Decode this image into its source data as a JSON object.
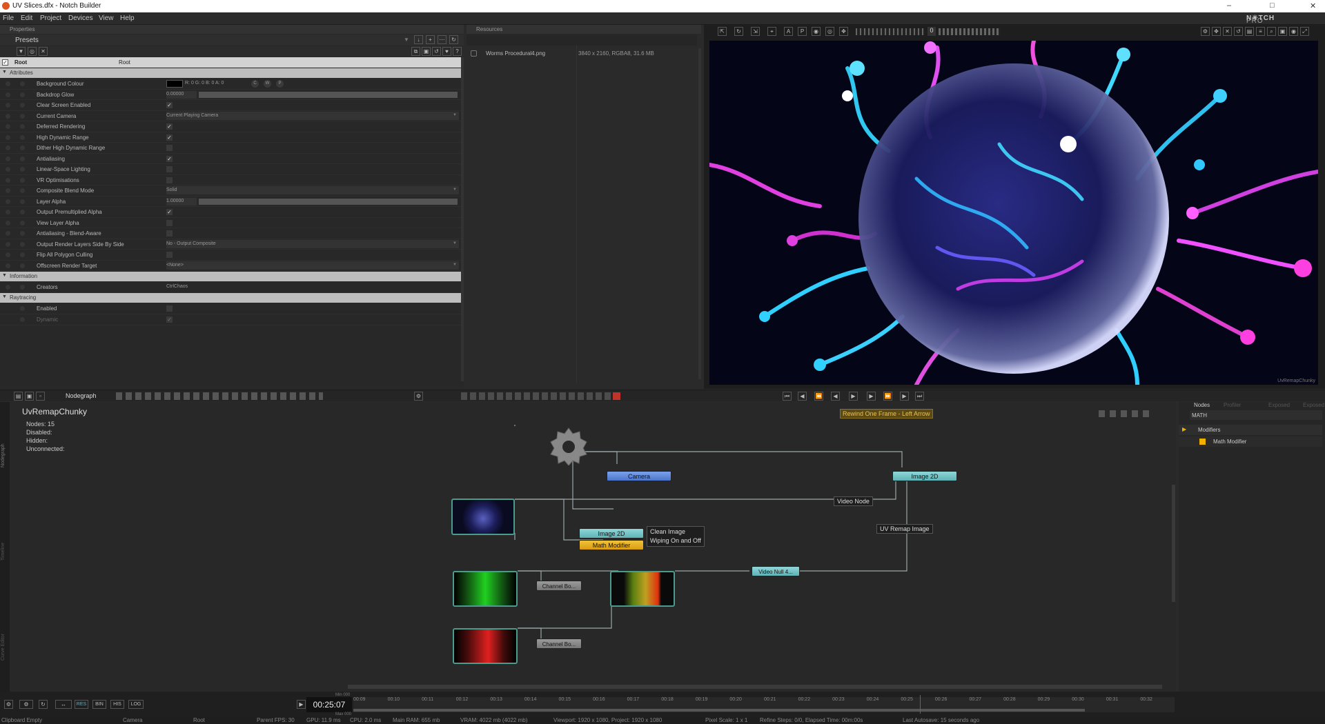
{
  "window": {
    "title": "UV Slices.dfx - Notch Builder",
    "controls": [
      "–",
      "□",
      "✕"
    ]
  },
  "menu": [
    "File",
    "Edit",
    "Project",
    "Devices",
    "View",
    "Help"
  ],
  "brand": {
    "name": "N✳TCH",
    "edition": "PRO"
  },
  "properties": {
    "tab": "Properties",
    "presets_label": "Presets",
    "root": {
      "name": "Root",
      "type": "Root"
    },
    "sections": {
      "attributes": "Attributes",
      "information": "Information",
      "raytracing": "Raytracing"
    },
    "attributes": [
      {
        "label": "Background Colour",
        "value": "R: 0 G: 0 B: 0 A: 0",
        "kind": "color",
        "extras": [
          "C",
          "W",
          "P"
        ]
      },
      {
        "label": "Backdrop Glow",
        "value": "0.00000",
        "kind": "slider"
      },
      {
        "label": "Clear Screen Enabled",
        "value": "✓",
        "kind": "check"
      },
      {
        "label": "Current Camera",
        "value": "Current Playing Camera",
        "kind": "dropdown"
      },
      {
        "label": "Deferred Rendering",
        "value": "✓",
        "kind": "check"
      },
      {
        "label": "High Dynamic Range",
        "value": "✓",
        "kind": "check"
      },
      {
        "label": "Dither High Dynamic Range",
        "value": "",
        "kind": "check"
      },
      {
        "label": "Antialiasing",
        "value": "✓",
        "kind": "check"
      },
      {
        "label": "Linear-Space Lighting",
        "value": "",
        "kind": "check"
      },
      {
        "label": "VR Optimisations",
        "value": "",
        "kind": "check"
      },
      {
        "label": "Composite Blend Mode",
        "value": "Solid",
        "kind": "dropdown"
      },
      {
        "label": "Layer Alpha",
        "value": "1.00000",
        "kind": "slider"
      },
      {
        "label": "Output Premultiplied Alpha",
        "value": "✓",
        "kind": "check"
      },
      {
        "label": "View Layer Alpha",
        "value": "",
        "kind": "check"
      },
      {
        "label": "Antialiasing - Blend-Aware",
        "value": "",
        "kind": "check"
      },
      {
        "label": "Output Render Layers Side By Side",
        "value": "No - Output Composite",
        "kind": "dropdown"
      },
      {
        "label": "Flip All Polygon Culling",
        "value": "",
        "kind": "check"
      },
      {
        "label": "Offscreen Render Target",
        "value": "<None>",
        "kind": "dropdown"
      }
    ],
    "information": [
      {
        "label": "Creators",
        "value": "CtrlChaos"
      }
    ],
    "raytracing": [
      {
        "label": "Enabled",
        "value": ""
      },
      {
        "label": "Dynamic",
        "value": "✓"
      }
    ]
  },
  "resources": {
    "tab": "Resources",
    "items": [
      {
        "name": "Worms Procedural4.png",
        "info": "3840 x 2160, RGBA8, 31.6 MB"
      }
    ]
  },
  "viewport": {
    "corner_label": "UvRemapChunky",
    "reading": "0"
  },
  "nodegraph": {
    "tab": "Nodegraph",
    "layer_name": "UvRemapChunky",
    "stats": [
      "Nodes:  15",
      "Disabled:",
      "Hidden:",
      "Unconnected:"
    ],
    "tooltip": "Rewind One Frame - Left Arrow",
    "side_tabs": [
      "Nodegraph",
      "Timeline",
      "Curve Editor"
    ],
    "nodes": {
      "camera": "Camera",
      "image2d_top": "Image 2D",
      "image2d_mid": "Image 2D",
      "math": "Math Modifier",
      "video_null": "Video Null 4...",
      "channel_1": "Channel Bo...",
      "channel_2": "Channel Bo..."
    },
    "labels": {
      "video_node": "Video Node",
      "uv_remap": "UV Remap Image",
      "clean_1": "Clean Image",
      "clean_2": "Wiping On and Off"
    }
  },
  "nodes_panel": {
    "tabs": [
      "Nodes",
      "Profiler",
      "Exposed",
      "Exposed"
    ],
    "search": "MATH",
    "category": "Modifiers",
    "item": "Math Modifier",
    "accent": "#f0b000"
  },
  "timeline": {
    "current_time": "00:25:07",
    "min_label": "Min 000",
    "max_label": "Max 000",
    "buttons": [
      "RES",
      "BIN",
      "HIS",
      "LOG"
    ],
    "ticks": [
      "00:09",
      "00:10",
      "00:11",
      "00:12",
      "00:13",
      "00:14",
      "00:15",
      "00:16",
      "00:17",
      "00:18",
      "00:19",
      "00:20",
      "00:21",
      "00:22",
      "00:23",
      "00:24",
      "00:25",
      "00:26",
      "00:27",
      "00:28",
      "00:29",
      "00:30",
      "00:31",
      "00:32"
    ]
  },
  "status": [
    "Clipboard Empty",
    "Camera",
    "Root",
    "Parent FPS: 30",
    "GPU: 11.9 ms",
    "CPU: 2.0 ms",
    "Main RAM: 655 mb",
    "VRAM: 4022 mb (4022 mb)",
    "Viewport: 1920 x 1080, Project: 1920 x 1080",
    "Pixel Scale: 1 x 1",
    "Refine Steps: 0/0, Elapsed Time: 00m:00s",
    "Last Autosave: 15 seconds ago"
  ]
}
